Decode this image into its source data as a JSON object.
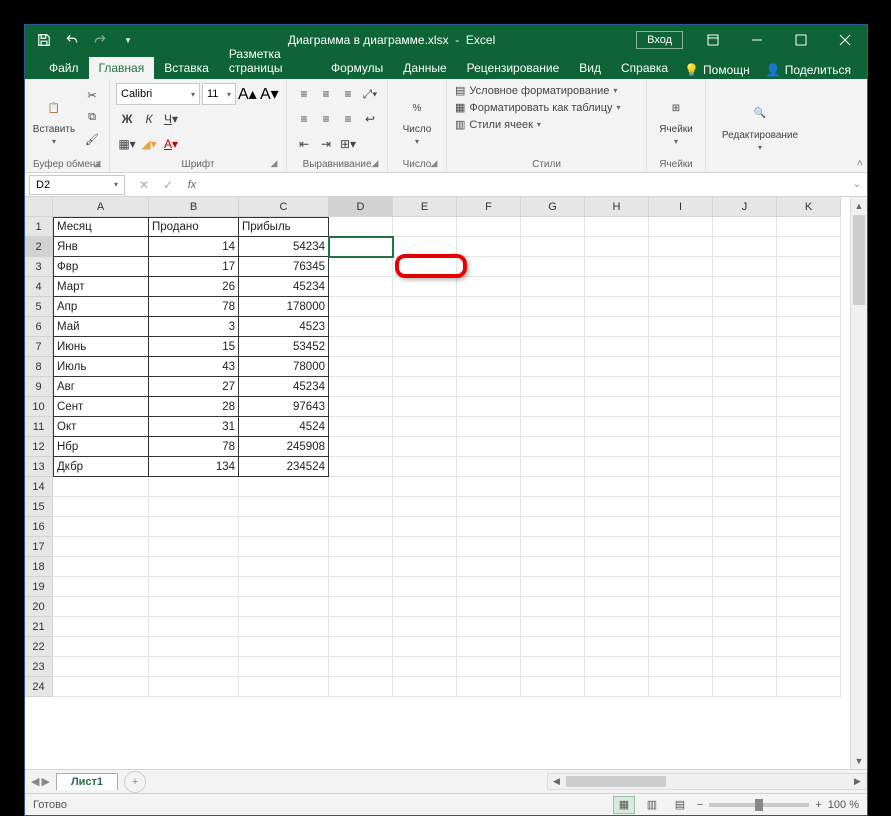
{
  "titlebar": {
    "filename": "Диаграмма в диаграмме.xlsx",
    "appname": "Excel",
    "login": "Вход"
  },
  "tabs": {
    "file": "Файл",
    "home": "Главная",
    "insert": "Вставка",
    "layout": "Разметка страницы",
    "formulas": "Формулы",
    "data": "Данные",
    "review": "Рецензирование",
    "view": "Вид",
    "help": "Справка",
    "tellme": "Помощн",
    "share": "Поделиться"
  },
  "ribbon": {
    "clipboard": {
      "paste": "Вставить",
      "label": "Буфер обмена"
    },
    "font": {
      "name": "Calibri",
      "size": "11",
      "label": "Шрифт"
    },
    "alignment": {
      "label": "Выравнивание"
    },
    "number": {
      "big": "Число",
      "label": "Число"
    },
    "styles": {
      "cond": "Условное форматирование",
      "table": "Форматировать как таблицу",
      "cell": "Стили ячеек",
      "label": "Стили"
    },
    "cells": {
      "big": "Ячейки",
      "label": "Ячейки"
    },
    "editing": {
      "big": "Редактирование",
      "label": ""
    }
  },
  "namebox": "D2",
  "sheet": {
    "columns": [
      "A",
      "B",
      "C",
      "D",
      "E",
      "F",
      "G",
      "H",
      "I",
      "J",
      "K"
    ],
    "headers": {
      "a": "Месяц",
      "b": "Продано",
      "c": "Прибыль"
    },
    "rows": [
      {
        "a": "Янв",
        "b": "14",
        "c": "54234"
      },
      {
        "a": "Фвр",
        "b": "17",
        "c": "76345"
      },
      {
        "a": "Март",
        "b": "26",
        "c": "45234"
      },
      {
        "a": "Апр",
        "b": "78",
        "c": "178000"
      },
      {
        "a": "Май",
        "b": "3",
        "c": "4523"
      },
      {
        "a": "Июнь",
        "b": "15",
        "c": "53452"
      },
      {
        "a": "Июль",
        "b": "43",
        "c": "78000"
      },
      {
        "a": "Авг",
        "b": "27",
        "c": "45234"
      },
      {
        "a": "Сент",
        "b": "28",
        "c": "97643"
      },
      {
        "a": "Окт",
        "b": "31",
        "c": "4524"
      },
      {
        "a": "Нбр",
        "b": "78",
        "c": "245908"
      },
      {
        "a": "Дкбр",
        "b": "134",
        "c": "234524"
      }
    ],
    "tab": "Лист1"
  },
  "status": {
    "ready": "Готово",
    "zoom": "100 %"
  },
  "colors": {
    "accent": "#217346"
  }
}
